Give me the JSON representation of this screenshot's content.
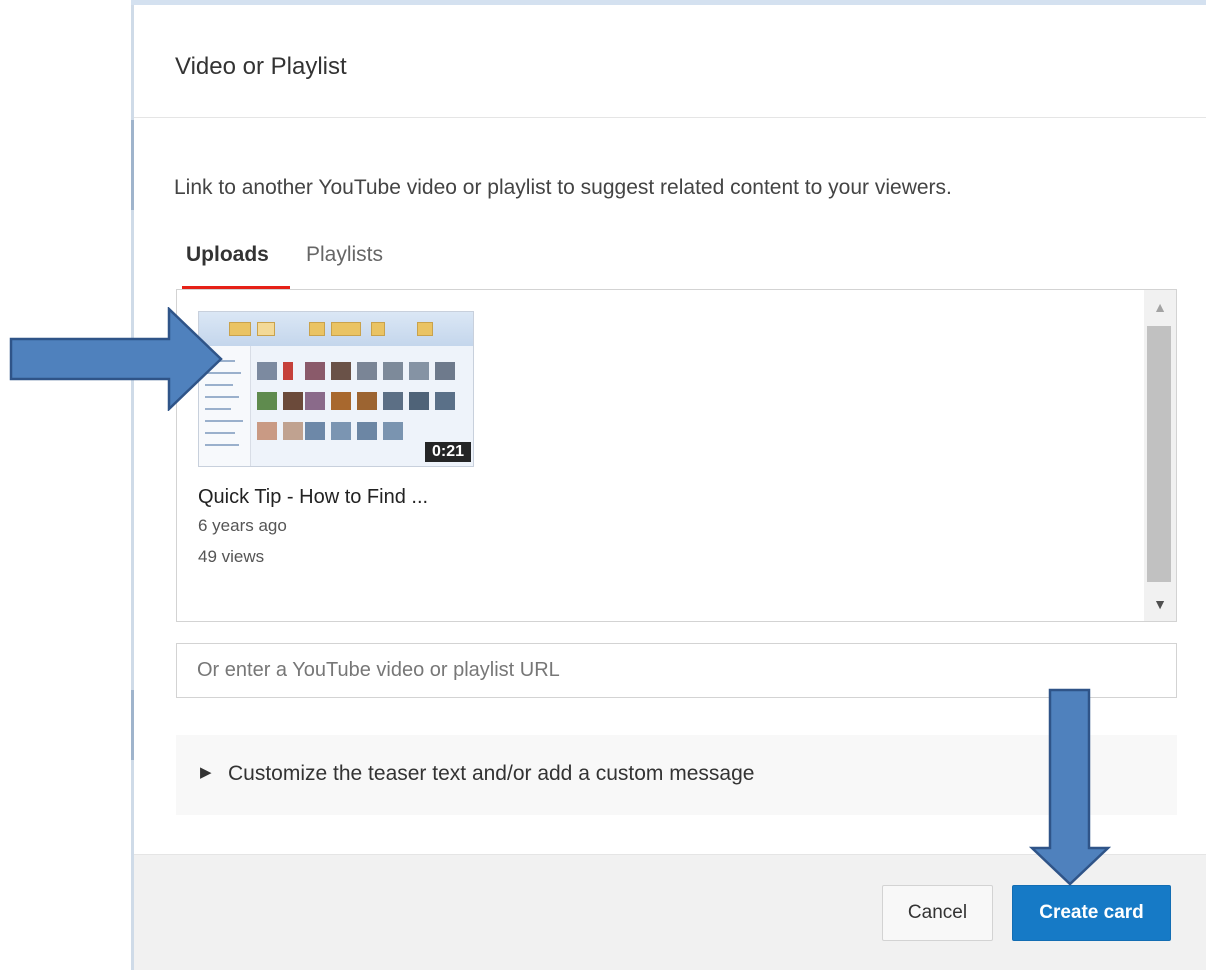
{
  "dialog": {
    "title": "Video or Playlist",
    "description": "Link to another YouTube video or playlist to suggest related content to your viewers."
  },
  "tabs": [
    {
      "label": "Uploads",
      "active": true
    },
    {
      "label": "Playlists",
      "active": false
    }
  ],
  "uploads": [
    {
      "title": "Quick Tip - How to Find ...",
      "age": "6 years ago",
      "views": "49 views",
      "duration": "0:21"
    }
  ],
  "url_input": {
    "value": "",
    "placeholder": "Or enter a YouTube video or playlist URL"
  },
  "teaser": {
    "label": "Customize the teaser text and/or add a custom message",
    "expanded": false
  },
  "footer": {
    "cancel_label": "Cancel",
    "create_label": "Create card"
  },
  "colors": {
    "accent": "#167ac6",
    "tab_underline": "#e62117",
    "annotation_arrow": "#4f81bd"
  }
}
